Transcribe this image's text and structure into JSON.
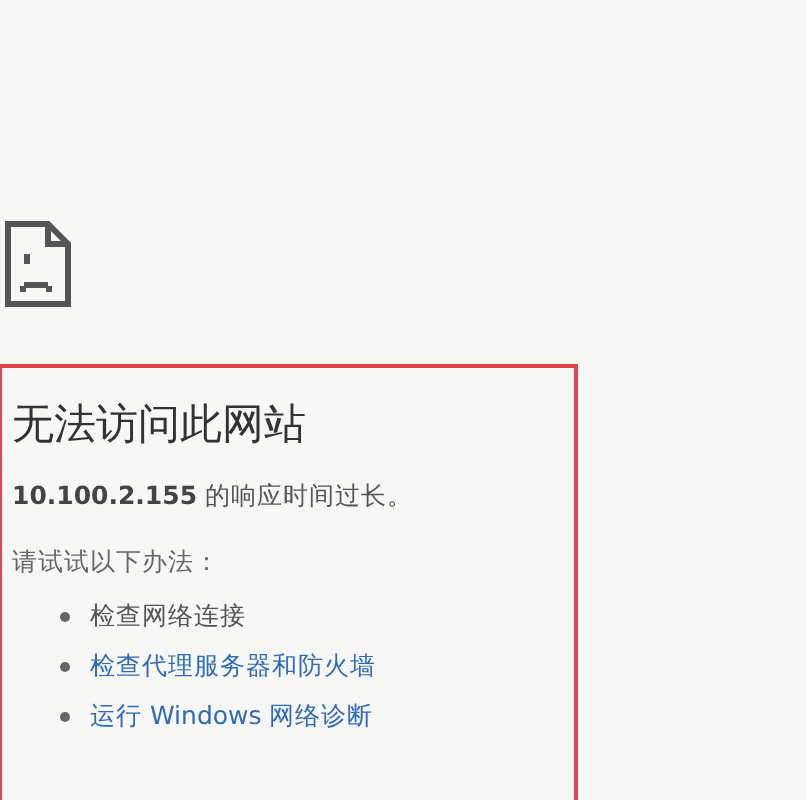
{
  "error": {
    "title": "无法访问此网站",
    "message": "**10.100.2.155** 的响应时间过长。",
    "suggestions_heading": "请试试以下办法：",
    "suggestions": [
      {
        "kind": "text",
        "label": "检查网络连接"
      },
      {
        "kind": "link",
        "label": "检查代理服务器和防火墙"
      },
      {
        "kind": "link",
        "label": "运行 Windows 网络诊断"
      }
    ]
  }
}
